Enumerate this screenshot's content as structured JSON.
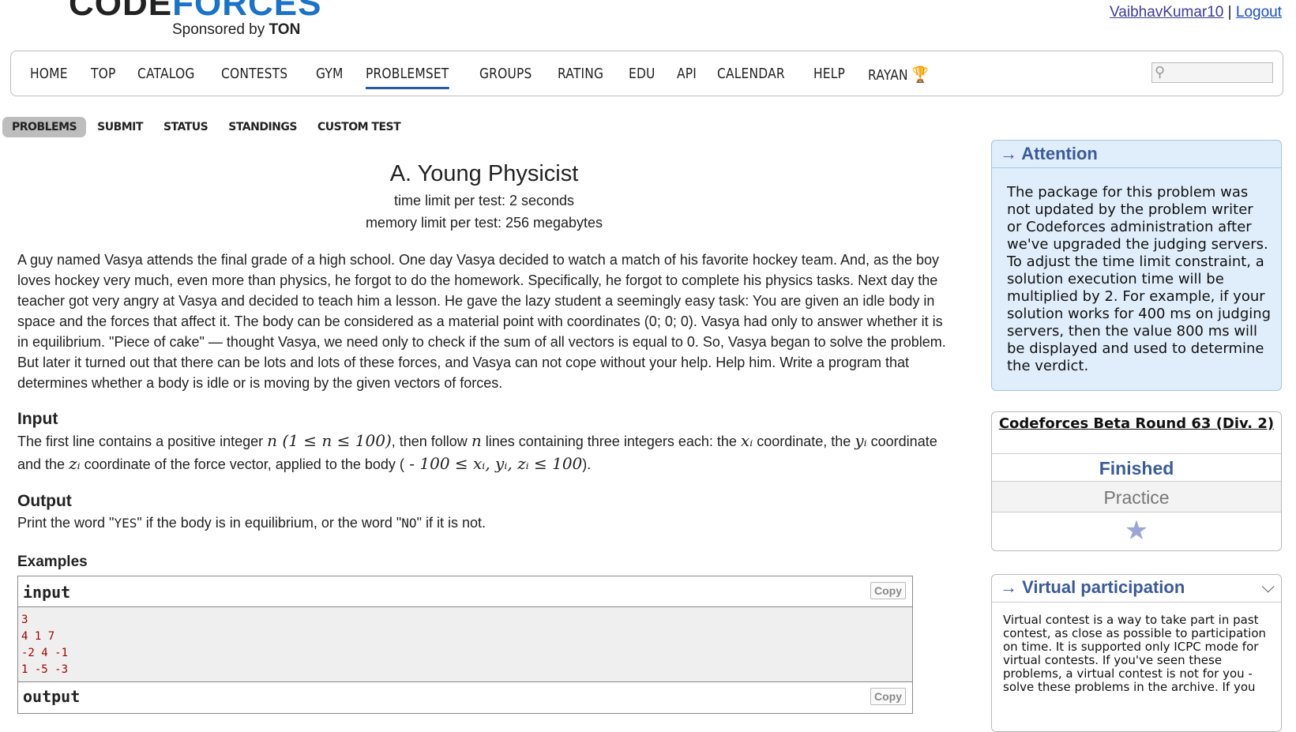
{
  "header": {
    "logo_word_1": "CODE",
    "logo_word_2": "FORCES",
    "sponsor_prefix": "Sponsored by",
    "sponsor_name": "TON",
    "username": "VaibhavKumar10",
    "separator": "|",
    "logout": "Logout"
  },
  "menu": {
    "items": [
      "HOME",
      "TOP",
      "CATALOG",
      "CONTESTS",
      "GYM",
      "PROBLEMSET",
      "GROUPS",
      "RATING",
      "EDU",
      "API",
      "CALENDAR",
      "HELP",
      "RAYAN"
    ],
    "active": "PROBLEMSET",
    "search_placeholder": ""
  },
  "submenu": {
    "items": [
      "PROBLEMS",
      "SUBMIT",
      "STATUS",
      "STANDINGS",
      "CUSTOM TEST"
    ],
    "active": "PROBLEMS"
  },
  "problem": {
    "title": "A. Young Physicist",
    "time_limit": "time limit per test: 2 seconds",
    "memory_limit": "memory limit per test: 256 megabytes",
    "legend": "A guy named Vasya attends the final grade of a high school. One day Vasya decided to watch a match of his favorite hockey team. And, as the boy loves hockey very much, even more than physics, he forgot to do the homework. Specifically, he forgot to complete his physics tasks. Next day the teacher got very angry at Vasya and decided to teach him a lesson. He gave the lazy student a seemingly easy task: You are given an idle body in space and the forces that affect it. The body can be considered as a material point with coordinates (0; 0; 0). Vasya had only to answer whether it is in equilibrium. \"Piece of cake\" — thought Vasya, we need only to check if the sum of all vectors is equal to 0. So, Vasya began to solve the problem. But later it turned out that there can be lots and lots of these forces, and Vasya can not cope without your help. Help him. Write a program that determines whether a body is idle or is moving by the given vectors of forces.",
    "input_title": "Input",
    "input_part1": "The first line contains a positive integer ",
    "input_math1": "n (1 ≤ n ≤ 100)",
    "input_part2": ", then follow ",
    "input_math2": "n",
    "input_part3": " lines containing three integers each: the ",
    "input_math3": "xᵢ",
    "input_part4": " coordinate, the ",
    "input_math4": "yᵢ",
    "input_part5": " coordinate and the ",
    "input_math5": "zᵢ",
    "input_part6": " coordinate of the force vector, applied to the body (",
    "input_math6": " - 100 ≤ xᵢ, yᵢ, zᵢ ≤ 100",
    "input_part7": ").",
    "output_title": "Output",
    "output_part1": "Print the word \"",
    "output_yes": "YES",
    "output_part2": "\" if the body is in equilibrium, or the word \"",
    "output_no": "NO",
    "output_part3": "\" if it is not.",
    "examples_title": "Examples",
    "sample_input_label": "input",
    "sample_output_label": "output",
    "copy_label": "Copy",
    "sample_input": "3\n4 1 7\n-2 4 -1\n1 -5 -3"
  },
  "sidebar": {
    "attention_title": "→ Attention",
    "attention_text": "The package for this problem was not updated by the problem writer or Codeforces administration after we've upgraded the judging servers. To adjust the time limit constraint, a solution execution time will be multiplied by 2. For example, if your solution works for 400 ms on judging servers, then the value 800 ms will be displayed and used to determine the verdict.",
    "round_name": "Codeforces Beta Round 63 (Div. 2)",
    "round_status": "Finished",
    "round_mode": "Practice",
    "virtual_title": "→ Virtual participation",
    "virtual_text": "Virtual contest is a way to take part in past contest, as close as possible to participation on time. It is supported only ICPC mode for virtual contests. If you've seen these problems, a virtual contest is not for you - solve these problems in the archive. If you"
  },
  "colors": {
    "logo_yellow": "#f6c23e",
    "logo_blue": "#1a73c9",
    "logo_red": "#c92a2a",
    "accent": "#3b5a9a",
    "attention_bg": "#e0eefb"
  }
}
